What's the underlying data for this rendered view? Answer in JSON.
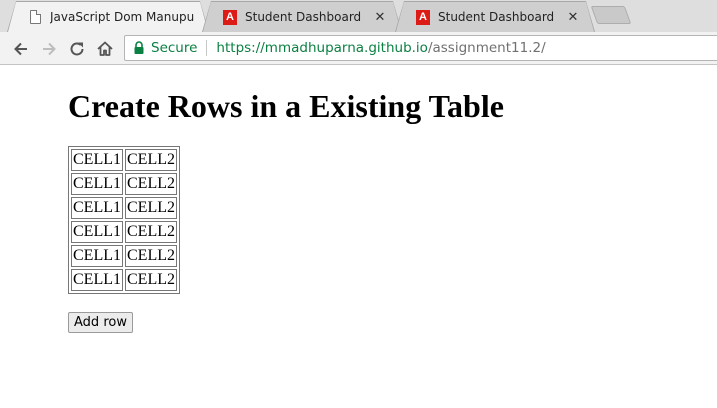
{
  "browser": {
    "tabs": [
      {
        "title": "JavaScript Dom Manupul",
        "favicon": "document-icon",
        "active": true
      },
      {
        "title": "Student Dashboard",
        "favicon": "angular-icon",
        "favicon_letter": "A",
        "active": false
      },
      {
        "title": "Student Dashboard",
        "favicon": "angular-icon",
        "favicon_letter": "A",
        "active": false
      }
    ],
    "close_glyph": "✕",
    "security_label": "Secure",
    "url_scheme_host": "https://mmadhuparna.github.io",
    "url_path": "/assignment11.2/",
    "secure_color": "#0b8043"
  },
  "page": {
    "heading": "Create Rows in a Existing Table",
    "table_rows": [
      [
        "CELL1",
        "CELL2"
      ],
      [
        "CELL1",
        "CELL2"
      ],
      [
        "CELL1",
        "CELL2"
      ],
      [
        "CELL1",
        "CELL2"
      ],
      [
        "CELL1",
        "CELL2"
      ],
      [
        "CELL1",
        "CELL2"
      ]
    ],
    "add_row_label": "Add row"
  }
}
